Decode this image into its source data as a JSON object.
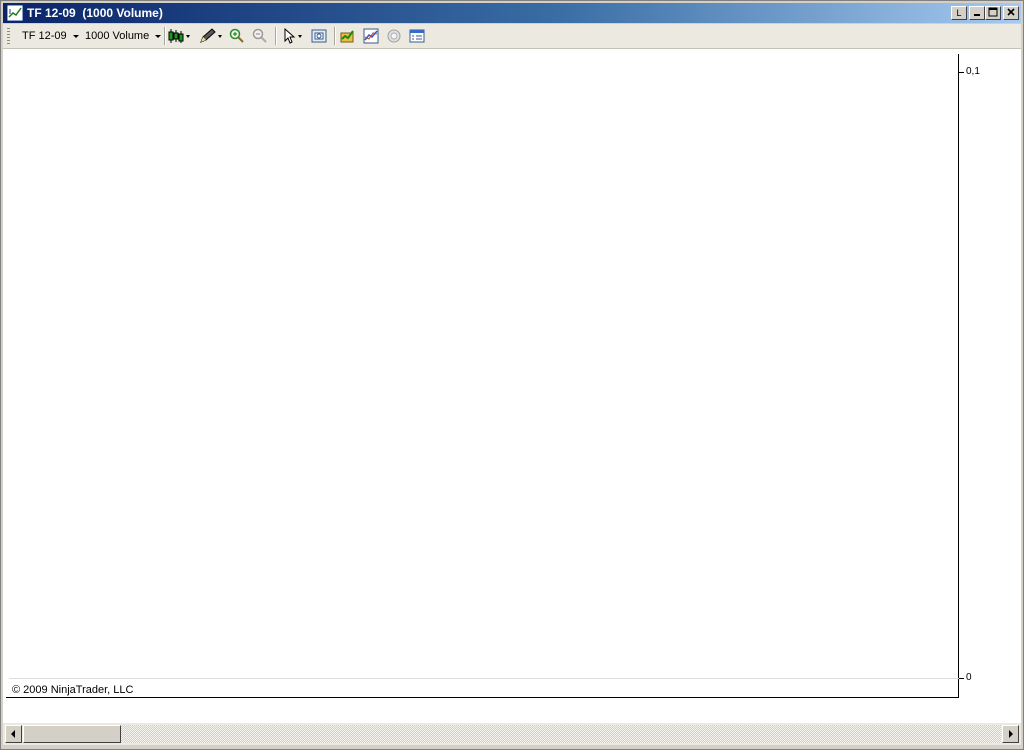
{
  "window": {
    "title": "TF 12-09  (1000 Volume)",
    "link_label": "L"
  },
  "toolbar": {
    "instrument": "TF 12-09",
    "interval": "1000 Volume",
    "icons": [
      "chart-style-icon",
      "drawing-tools-icon",
      "zoom-in-icon",
      "zoom-out-icon",
      "pointer-icon",
      "data-box-icon",
      "indicators-icon",
      "strategies-icon",
      "properties-icon",
      "data-series-icon"
    ]
  },
  "chart": {
    "y_axis_labels": [
      "0,1",
      "0"
    ],
    "copyright": "© 2009 NinjaTrader, LLC"
  },
  "scrollbar": {
    "position": 0.0,
    "thumb_fraction": 0.1
  },
  "colors": {
    "titlebar_start": "#0a246a",
    "titlebar_end": "#a6caf0",
    "chart_background": "#ffffff"
  }
}
